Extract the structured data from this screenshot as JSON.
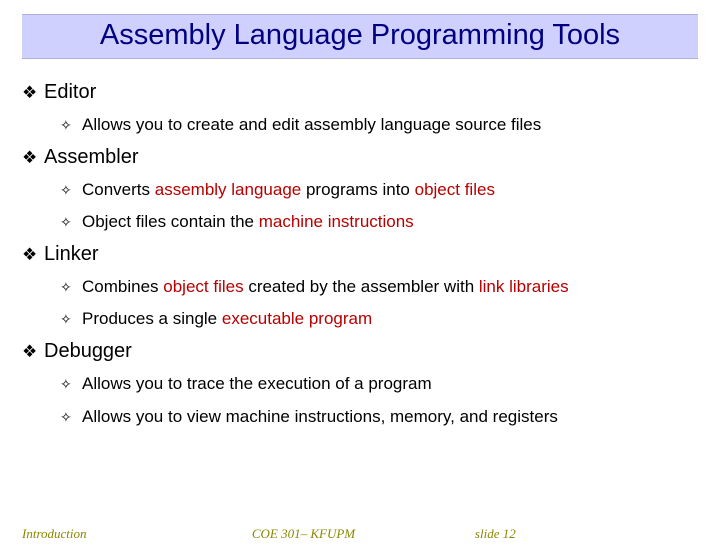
{
  "title": "Assembly Language Programming Tools",
  "sections": [
    {
      "heading": "Editor",
      "items": [
        {
          "segs": [
            {
              "t": "Allows you to create and edit assembly language source files"
            }
          ]
        }
      ]
    },
    {
      "heading": "Assembler",
      "items": [
        {
          "segs": [
            {
              "t": "Converts "
            },
            {
              "t": "assembly language",
              "hl": true
            },
            {
              "t": " programs into "
            },
            {
              "t": "object files",
              "hl": true
            }
          ]
        },
        {
          "segs": [
            {
              "t": "Object files contain the "
            },
            {
              "t": "machine instructions",
              "hl": true
            }
          ]
        }
      ]
    },
    {
      "heading": "Linker",
      "items": [
        {
          "segs": [
            {
              "t": "Combines "
            },
            {
              "t": "object files",
              "hl": true
            },
            {
              "t": " created by the assembler with "
            },
            {
              "t": "link libraries",
              "hl": true
            }
          ]
        },
        {
          "segs": [
            {
              "t": "Produces a single "
            },
            {
              "t": "executable program",
              "hl": true
            }
          ]
        }
      ]
    },
    {
      "heading": "Debugger",
      "items": [
        {
          "segs": [
            {
              "t": "Allows you to trace the execution of a program"
            }
          ]
        },
        {
          "segs": [
            {
              "t": "Allows you to view machine instructions, memory, and registers"
            }
          ]
        }
      ]
    }
  ],
  "footer": {
    "left": "Introduction",
    "center": "COE 301– KFUPM",
    "right": "slide 12"
  },
  "bullets": {
    "l1": "❖",
    "l2": "✧"
  }
}
